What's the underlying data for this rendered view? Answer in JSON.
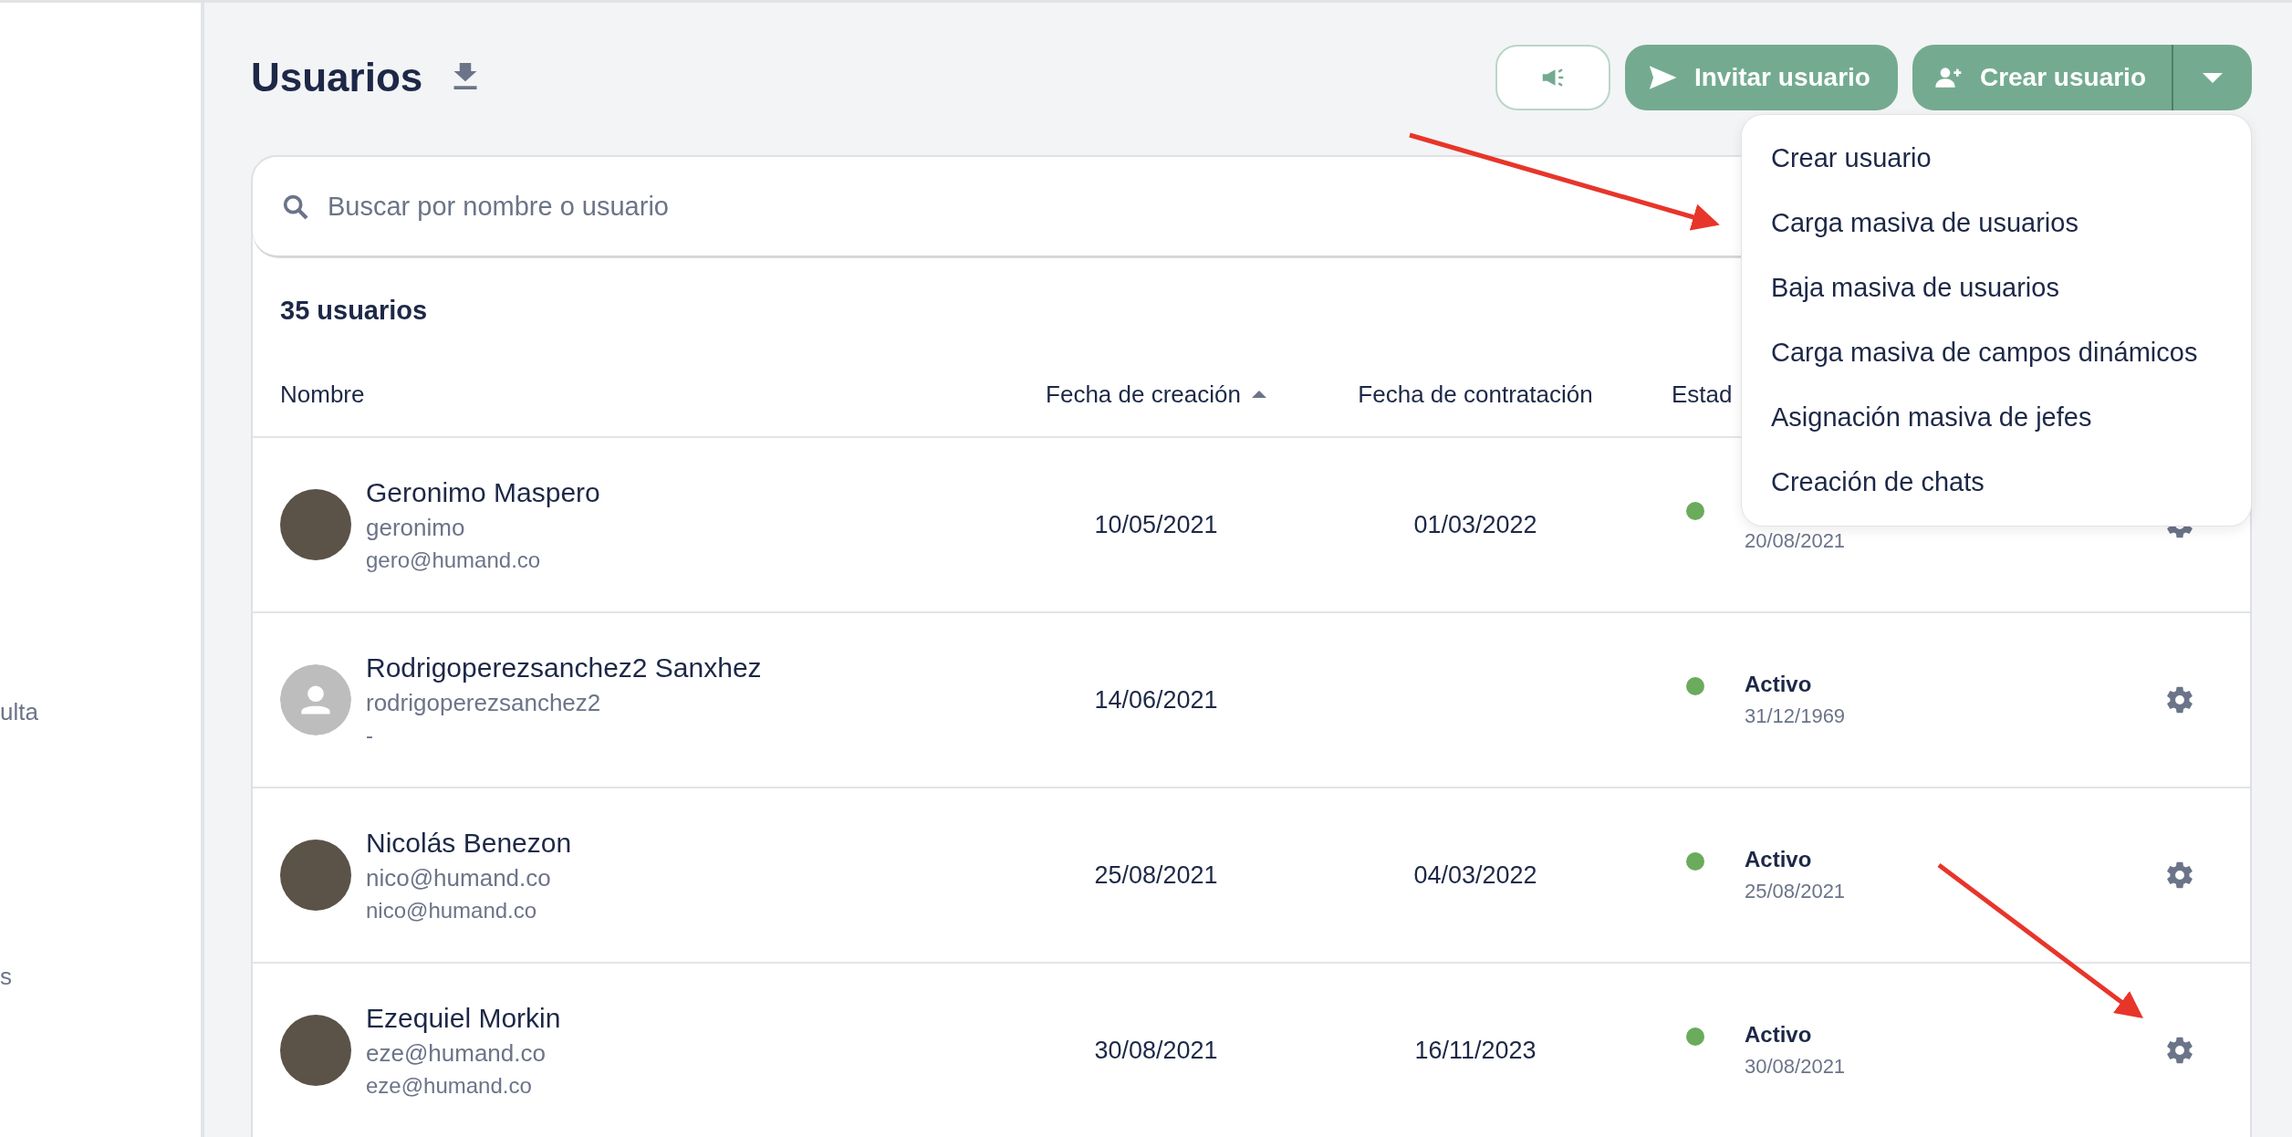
{
  "sidebar": {
    "items": [
      "ulta",
      "s"
    ]
  },
  "header": {
    "title": "Usuarios",
    "buttons": [
      {
        "kind": "icon"
      },
      {
        "kind": "invite",
        "label": "Invitar usuario"
      },
      {
        "kind": "create",
        "label": "Crear usuario"
      }
    ]
  },
  "create_menu": {
    "expanded": true,
    "items": [
      "Crear usuario",
      "Carga masiva de usuarios",
      "Baja masiva de usuarios",
      "Carga masiva de campos dinámicos",
      "Asignación masiva de jefes",
      "Creación de chats"
    ]
  },
  "search": {
    "placeholder": "Buscar por nombre o usuario"
  },
  "count": "35 usuarios",
  "table": {
    "columns": [
      {
        "label": "Nombre",
        "sorted": false
      },
      {
        "label": "Fecha de creación",
        "sorted": true
      },
      {
        "label": "Fecha de contratación",
        "sorted": false
      },
      {
        "label": "Estad",
        "sorted": false
      }
    ],
    "rows": [
      {
        "has_photo": true,
        "name": "Geronimo Maspero",
        "username": "geronimo",
        "email": "gero@humand.co",
        "created": "10/05/2021",
        "hired": "01/03/2022",
        "status": "",
        "status_date": "20/08/2021"
      },
      {
        "has_photo": false,
        "name": "Rodrigoperezsanchez2 Sanxhez",
        "username": "rodrigoperezsanchez2",
        "email": "-",
        "created": "14/06/2021",
        "hired": "",
        "status": "Activo",
        "status_date": "31/12/1969"
      },
      {
        "has_photo": true,
        "name": "Nicolás Benezon",
        "username": "nico@humand.co",
        "email": "nico@humand.co",
        "created": "25/08/2021",
        "hired": "04/03/2022",
        "status": "Activo",
        "status_date": "25/08/2021"
      },
      {
        "has_photo": true,
        "name": "Ezequiel Morkin",
        "username": "eze@humand.co",
        "email": "eze@humand.co",
        "created": "30/08/2021",
        "hired": "16/11/2023",
        "status": "Activo",
        "status_date": "30/08/2021"
      }
    ]
  }
}
